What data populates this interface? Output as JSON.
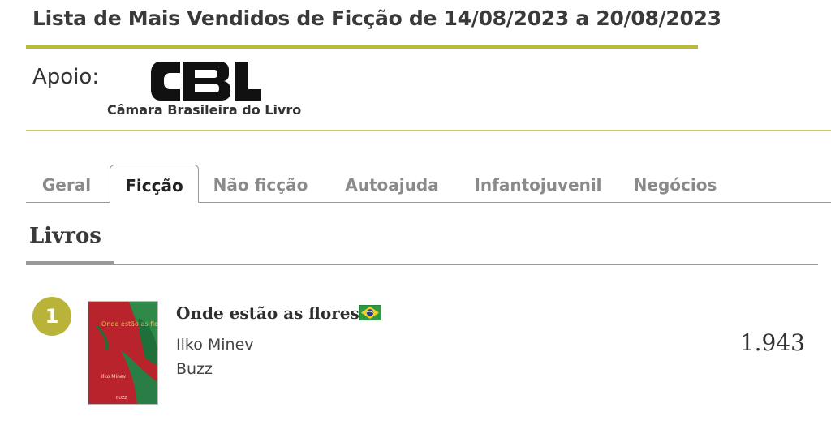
{
  "header": {
    "title": "Lista de Mais Vendidos de Ficção de 14/08/2023 a 20/08/2023",
    "accent_color": "#b9bb37"
  },
  "support": {
    "label": "Apoio:",
    "logo_text": "CBL",
    "logo_caption": "Câmara Brasileira do Livro"
  },
  "tabs": [
    {
      "label": "Geral",
      "active": false
    },
    {
      "label": "Ficção",
      "active": true
    },
    {
      "label": "Não ficção",
      "active": false
    },
    {
      "label": "Autoajuda",
      "active": false
    },
    {
      "label": "Infantojuvenil",
      "active": false
    },
    {
      "label": "Negócios",
      "active": false
    }
  ],
  "section": {
    "title": "Livros"
  },
  "books": [
    {
      "rank": "1",
      "title": "Onde estão as flores",
      "flag_icon": "brazil-flag-icon",
      "author": "Ilko Minev",
      "publisher": "Buzz",
      "sales": "1.943",
      "cover_title": "Onde estão as flores?",
      "cover_author": "Ilko Minev",
      "cover_publisher": "BUZZ"
    }
  ]
}
